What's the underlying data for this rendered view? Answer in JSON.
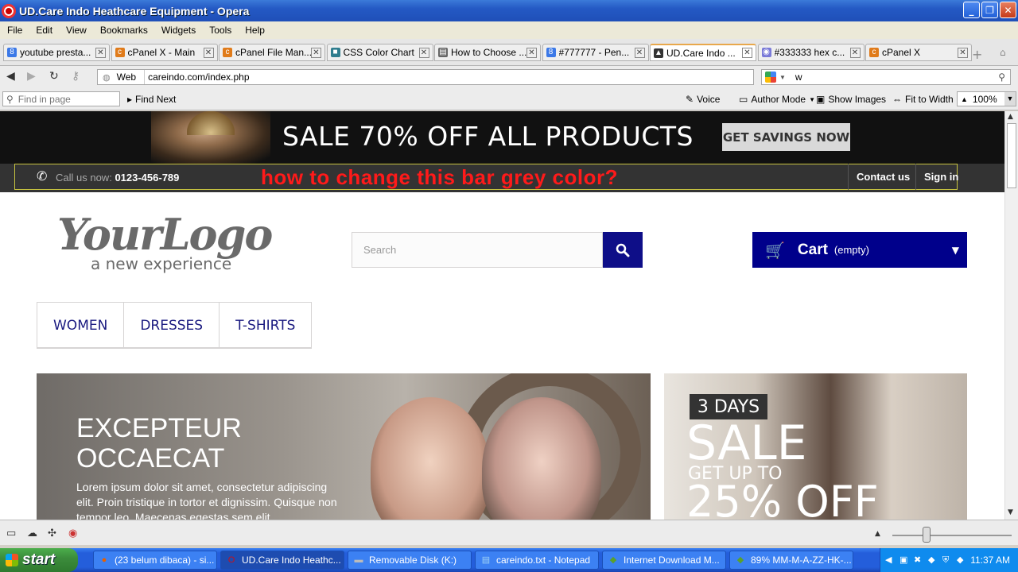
{
  "window": {
    "title": "UD.Care Indo Heathcare Equipment - Opera",
    "minimize": "_",
    "maximize": "❐",
    "close": "✕"
  },
  "menubar": [
    "File",
    "Edit",
    "View",
    "Bookmarks",
    "Widgets",
    "Tools",
    "Help"
  ],
  "tabs": [
    {
      "label": "youtube presta...",
      "icon": "google-icon",
      "color": "#3b78e7",
      "glyph": "8"
    },
    {
      "label": "cPanel X - Main",
      "icon": "cpanel-icon",
      "color": "#e07b1a",
      "glyph": "c"
    },
    {
      "label": "cPanel File Man...",
      "icon": "cpanel-icon",
      "color": "#e07b1a",
      "glyph": "c"
    },
    {
      "label": "CSS Color Chart",
      "icon": "page-icon",
      "color": "#2f7d8e",
      "glyph": "■"
    },
    {
      "label": "How to Choose ...",
      "icon": "document-icon",
      "color": "#666666",
      "glyph": "▤"
    },
    {
      "label": "#777777 - Pen...",
      "icon": "google-icon",
      "color": "#3b78e7",
      "glyph": "8"
    },
    {
      "label": "UD.Care Indo ...",
      "icon": "site-icon",
      "color": "#333333",
      "glyph": "▲",
      "active": true
    },
    {
      "label": "#333333 hex c...",
      "icon": "color-icon",
      "color": "#7a7ad8",
      "glyph": "◉"
    },
    {
      "label": "cPanel X",
      "icon": "cpanel-icon",
      "color": "#e07b1a",
      "glyph": "c"
    }
  ],
  "addressbar": {
    "web_label": "Web",
    "url": "careindo.com/index.php",
    "search_value": "w"
  },
  "findbar": {
    "placeholder": "Find in page",
    "find_next": "Find Next",
    "voice": "Voice",
    "author_mode": "Author Mode",
    "show_images": "Show Images",
    "fit_to_width": "Fit to Width",
    "zoom": "100%"
  },
  "page": {
    "banner": {
      "headline": "SALE 70% OFF ALL PRODUCTS",
      "cta": "GET SAVINGS NOW"
    },
    "nav": {
      "call_label": "Call us now:",
      "phone": "0123-456-789",
      "question": "how to change this bar grey color?",
      "contact": "Contact us",
      "signin": "Sign in"
    },
    "logo": {
      "main": "YourLogo",
      "sub": "a new experience"
    },
    "search_placeholder": "Search",
    "cart": {
      "label": "Cart",
      "status": "(empty)"
    },
    "menu": [
      "WOMEN",
      "DRESSES",
      "T-SHIRTS"
    ],
    "slide": {
      "title_line1": "EXCEPTEUR",
      "title_line2": "OCCAECAT",
      "body": "Lorem ipsum dolor sit amet, consectetur adipiscing elit. Proin tristique in tortor et dignissim. Quisque non tempor leo. Maecenas egestas sem elit"
    },
    "side_banner": {
      "days": "3 DAYS",
      "sale": "SALE",
      "getup": "GET UP TO",
      "percent": "25% OFF"
    }
  },
  "taskbar": {
    "start": "start",
    "tasks": [
      {
        "label": "(23 belum dibaca) - si...",
        "icon": "firefox-icon",
        "glyph": "●",
        "color": "#e66000"
      },
      {
        "label": "UD.Care Indo Heathc...",
        "icon": "opera-icon",
        "glyph": "O",
        "color": "#cc0f16",
        "active": true
      },
      {
        "label": "Removable Disk (K:)",
        "icon": "drive-icon",
        "glyph": "▬",
        "color": "#bbbbbb"
      },
      {
        "label": "careindo.txt - Notepad",
        "icon": "notepad-icon",
        "glyph": "▤",
        "color": "#9fd3f5"
      },
      {
        "label": "Internet Download M...",
        "icon": "idm-icon",
        "glyph": "◆",
        "color": "#5aa02c"
      },
      {
        "label": "89% MM-M-A-ZZ-HK-...",
        "icon": "download-icon",
        "glyph": "◆",
        "color": "#5aa02c"
      }
    ],
    "clock": "11:37 AM"
  }
}
